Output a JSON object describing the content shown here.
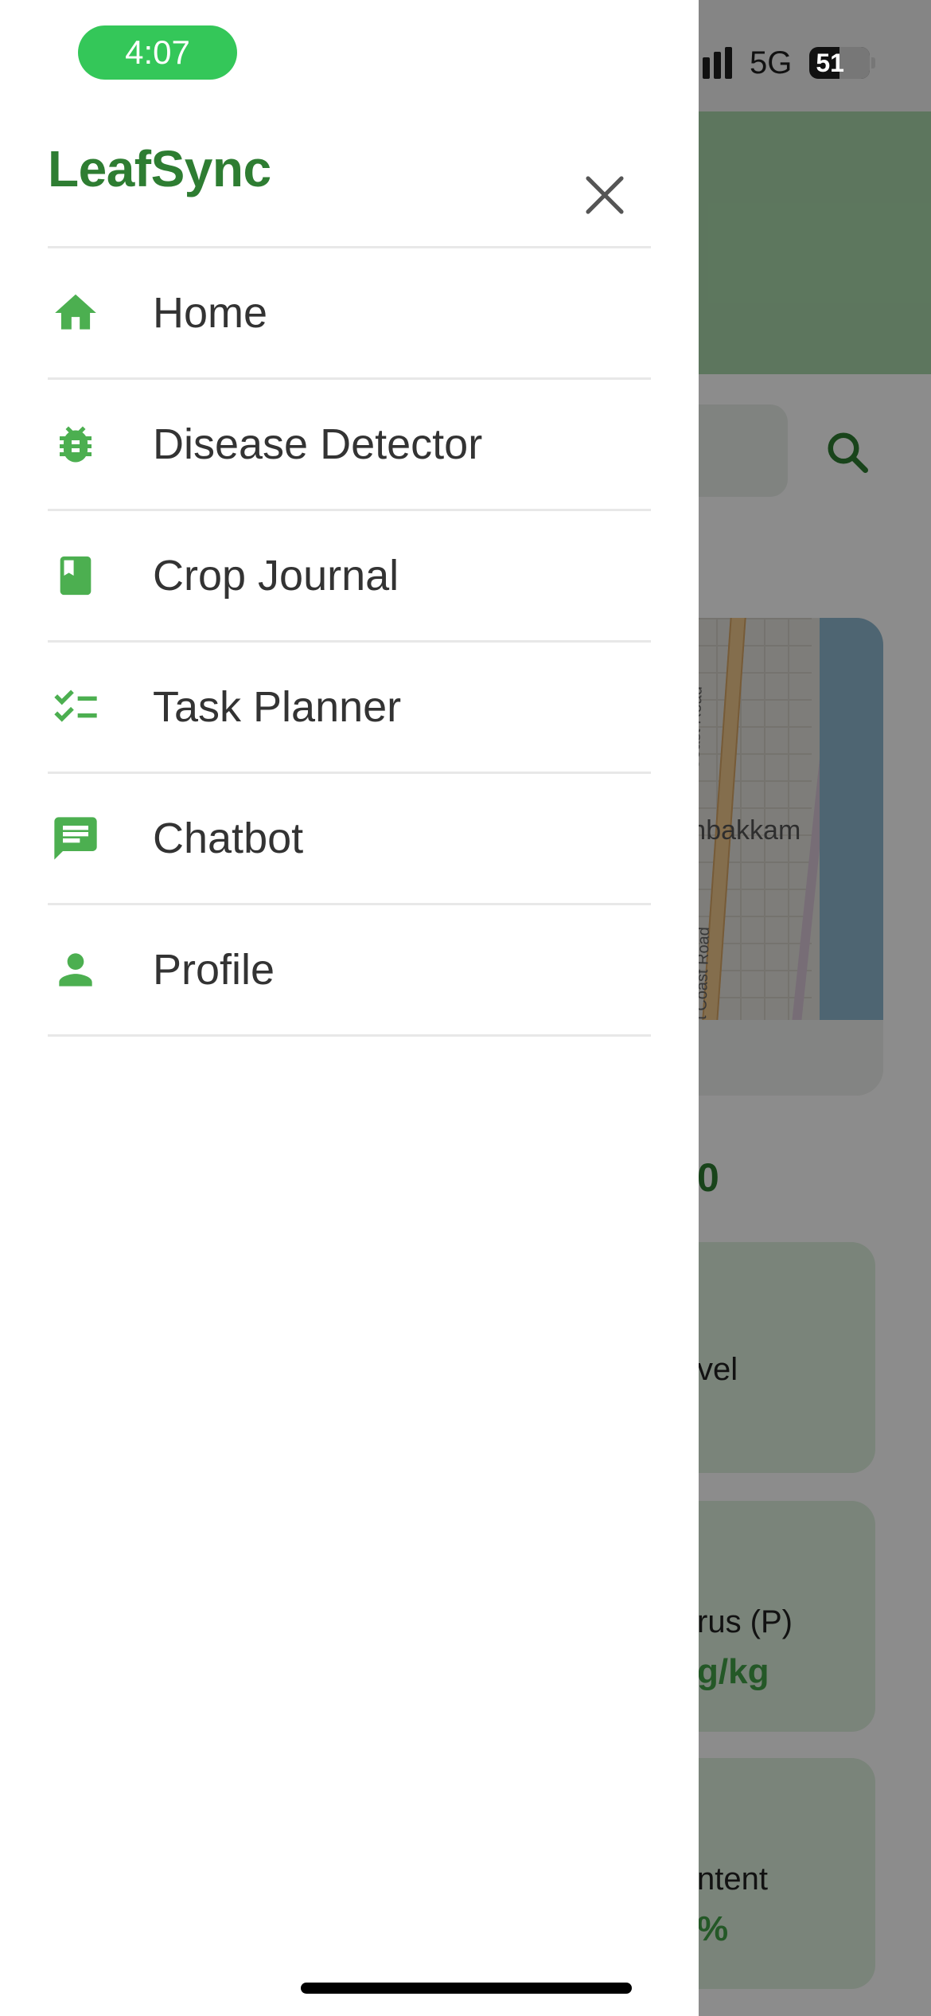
{
  "status_bar": {
    "time": "4:07",
    "network": "5G",
    "battery": "51"
  },
  "drawer": {
    "brand": "LeafSync",
    "close_icon": "close-icon",
    "items": [
      {
        "label": "Home",
        "icon": "home-icon"
      },
      {
        "label": "Disease Detector",
        "icon": "bug-icon"
      },
      {
        "label": "Crop Journal",
        "icon": "book-icon"
      },
      {
        "label": "Task Planner",
        "icon": "checklist-icon"
      },
      {
        "label": "Chatbot",
        "icon": "chat-icon"
      },
      {
        "label": "Profile",
        "icon": "person-icon"
      }
    ]
  },
  "background": {
    "map_place": "ambakkam",
    "map_road": "East Coast Road",
    "map_road_2": "st Coast Road",
    "date_partial": "0",
    "cards": [
      {
        "label": "vel",
        "value": ""
      },
      {
        "label": "rus (P)",
        "value": "g/kg"
      },
      {
        "label": "ntent",
        "value": "%"
      }
    ]
  },
  "colors": {
    "brand": "#2e7d32",
    "icon_green": "#4caf50",
    "status_pill": "#34c759"
  }
}
